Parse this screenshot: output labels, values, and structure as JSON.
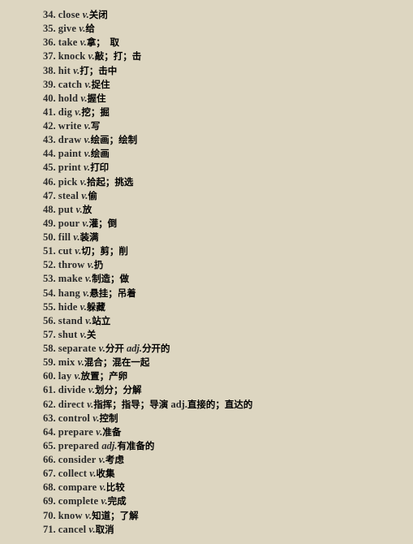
{
  "items": [
    {
      "num": "34.",
      "word": "close",
      "parts": [
        {
          "pos": "v.",
          "meaning": "关闭"
        }
      ]
    },
    {
      "num": "35.",
      "word": "give",
      "parts": [
        {
          "pos": "v.",
          "meaning": "给"
        }
      ]
    },
    {
      "num": "36.",
      "word": "take",
      "parts": [
        {
          "pos": "v.",
          "meaning": "拿；　取"
        }
      ]
    },
    {
      "num": "37.",
      "word": "knock",
      "parts": [
        {
          "pos": "v.",
          "meaning": "敲；打；击"
        }
      ]
    },
    {
      "num": "38.",
      "word": "hit",
      "parts": [
        {
          "pos": "v.",
          "meaning": "打；击中"
        }
      ]
    },
    {
      "num": "39.",
      "word": "catch",
      "parts": [
        {
          "pos": "v.",
          "meaning": "捉住"
        }
      ]
    },
    {
      "num": "40.",
      "word": "hold",
      "parts": [
        {
          "pos": "v.",
          "meaning": "握住"
        }
      ]
    },
    {
      "num": "41.",
      "word": "dig",
      "parts": [
        {
          "pos": "v.",
          "meaning": "挖；掘"
        }
      ]
    },
    {
      "num": "42.",
      "word": "write",
      "parts": [
        {
          "pos": "v.",
          "meaning": "写"
        }
      ]
    },
    {
      "num": "43.",
      "word": "draw",
      "parts": [
        {
          "pos": "v.",
          "meaning": "绘画；绘制"
        }
      ]
    },
    {
      "num": "44.",
      "word": "paint",
      "parts": [
        {
          "pos": "v.",
          "meaning": "绘画"
        }
      ]
    },
    {
      "num": "45.",
      "word": "print",
      "parts": [
        {
          "pos": "v.",
          "meaning": "打印"
        }
      ]
    },
    {
      "num": "46.",
      "word": "pick",
      "parts": [
        {
          "pos": "v.",
          "meaning": "拾起；挑选"
        }
      ]
    },
    {
      "num": "47.",
      "word": "steal",
      "parts": [
        {
          "pos": "v.",
          "meaning": "偷"
        }
      ]
    },
    {
      "num": "48.",
      "word": "put",
      "parts": [
        {
          "pos": "v.",
          "meaning": "放"
        }
      ]
    },
    {
      "num": "49.",
      "word": "pour",
      "parts": [
        {
          "pos": "v.",
          "meaning": "灌；倒"
        }
      ]
    },
    {
      "num": "50.",
      "word": "fill",
      "parts": [
        {
          "pos": "v.",
          "meaning": "装满"
        }
      ]
    },
    {
      "num": "51.",
      "word": "cut",
      "parts": [
        {
          "pos": "v.",
          "meaning": "切；剪；削"
        }
      ]
    },
    {
      "num": "52.",
      "word": "throw",
      "parts": [
        {
          "pos": "v.",
          "meaning": "扔"
        }
      ]
    },
    {
      "num": "53.",
      "word": "make",
      "parts": [
        {
          "pos": "v.",
          "meaning": "制造；做"
        }
      ]
    },
    {
      "num": "54.",
      "word": "hang",
      "parts": [
        {
          "pos": "v.",
          "meaning": "悬挂；吊着"
        }
      ]
    },
    {
      "num": "55.",
      "word": "hide",
      "parts": [
        {
          "pos": "v.",
          "meaning": "躲藏"
        }
      ]
    },
    {
      "num": "56.",
      "word": "stand",
      "parts": [
        {
          "pos": "v.",
          "meaning": "站立"
        }
      ]
    },
    {
      "num": "57.",
      "word": "shut",
      "parts": [
        {
          "pos": "v.",
          "meaning": "关"
        }
      ]
    },
    {
      "num": "58.",
      "word": "separate",
      "parts": [
        {
          "pos": "v.",
          "meaning": "分开"
        },
        {
          "pos": "adj.",
          "meaning": "分开的"
        }
      ]
    },
    {
      "num": "59.",
      "word": "mix",
      "parts": [
        {
          "pos": "v.",
          "meaning": "混合；混在一起"
        }
      ]
    },
    {
      "num": "60.",
      "word": "lay",
      "parts": [
        {
          "pos": "v.",
          "meaning": "放置；产卵"
        }
      ]
    },
    {
      "num": "61.",
      "word": "divide",
      "parts": [
        {
          "pos": "v.",
          "meaning": "划分；分解"
        }
      ]
    },
    {
      "num": "62.",
      "word": "direct",
      "parts": [
        {
          "pos": "v.",
          "meaning": "指挥；指导；导演"
        },
        {
          "pos": "adj.",
          "meaning": "直接的；直达的",
          "upright": true
        }
      ]
    },
    {
      "num": "63.",
      "word": "control",
      "parts": [
        {
          "pos": "v.",
          "meaning": "控制"
        }
      ]
    },
    {
      "num": "64.",
      "word": "prepare",
      "parts": [
        {
          "pos": "v.",
          "meaning": "准备"
        }
      ]
    },
    {
      "num": "65.",
      "word": "prepared",
      "parts": [
        {
          "pos": "adj.",
          "meaning": "有准备的"
        }
      ]
    },
    {
      "num": "66.",
      "word": "consider",
      "parts": [
        {
          "pos": "v.",
          "meaning": "考虑"
        }
      ]
    },
    {
      "num": "67.",
      "word": "collect",
      "parts": [
        {
          "pos": "v.",
          "meaning": "收集"
        }
      ]
    },
    {
      "num": "68.",
      "word": "compare",
      "parts": [
        {
          "pos": "v.",
          "meaning": "比较"
        }
      ]
    },
    {
      "num": "69.",
      "word": "complete",
      "parts": [
        {
          "pos": "v.",
          "meaning": "完成"
        }
      ]
    },
    {
      "num": "70.",
      "word": "know",
      "parts": [
        {
          "pos": "v.",
          "meaning": "知道；了解"
        }
      ]
    },
    {
      "num": "71.",
      "word": "cancel",
      "parts": [
        {
          "pos": "v.",
          "meaning": "取消"
        }
      ]
    }
  ]
}
